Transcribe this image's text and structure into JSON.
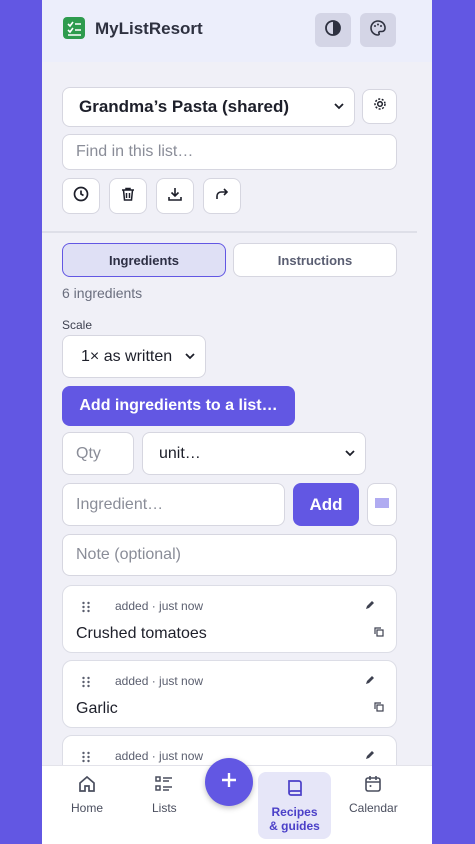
{
  "header": {
    "brand": "MyListResort",
    "icons": [
      "checklist-logo-icon",
      "contrast-icon",
      "palette-icon"
    ]
  },
  "list_select": {
    "value": "Grandma’s Pasta (shared)"
  },
  "search": {
    "placeholder": "Find in this list…"
  },
  "toolbar": {
    "icons": [
      "history-icon",
      "trash-icon",
      "download-icon",
      "share-icon",
      "settings-icon"
    ]
  },
  "tabs": [
    {
      "label": "Ingredients",
      "active": true
    },
    {
      "label": "Instructions",
      "active": false
    }
  ],
  "ingredient_count": "6 ingredients",
  "scale": {
    "label": "Scale",
    "value": "1× as written"
  },
  "add_to_list_label": "Add ingredients to a list…",
  "form": {
    "qty_placeholder": "Qty",
    "unit_value": "unit…",
    "ingredient_placeholder": "Ingredient…",
    "add_label": "Add",
    "note_placeholder": "Note (optional)"
  },
  "items": [
    {
      "meta": "added · just now",
      "name": "Crushed tomatoes"
    },
    {
      "meta": "added · just now",
      "name": "Garlic"
    },
    {
      "meta": "added · just now",
      "name": ""
    }
  ],
  "nav": [
    {
      "label": "Home",
      "icon": "home-icon"
    },
    {
      "label": "Lists",
      "icon": "list-icon"
    },
    {
      "label": "Recipes & guides",
      "icon": "book-icon"
    },
    {
      "label": "Calendar",
      "icon": "calendar-icon"
    }
  ],
  "colors": {
    "accent": "#6257e3",
    "background": "#f0f0f7"
  }
}
